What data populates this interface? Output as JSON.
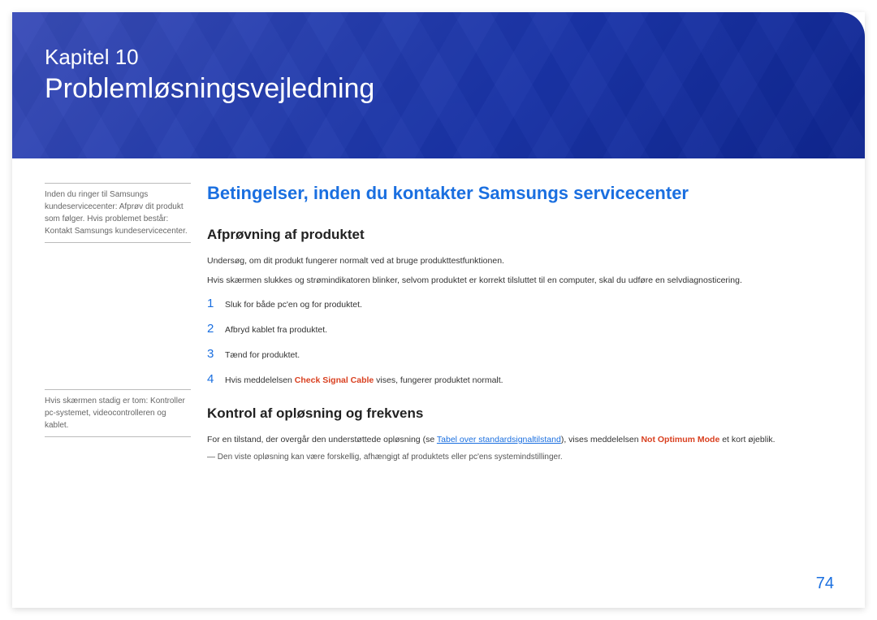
{
  "banner": {
    "chapter_label": "Kapitel 10",
    "chapter_title": "Problemløsningsvejledning"
  },
  "side": {
    "note1": "Inden du ringer til Samsungs kundeservicecenter: Afprøv dit produkt som følger. Hvis problemet består: Kontakt Samsungs kundeservicecenter.",
    "note2": "Hvis skærmen stadig er tom: Kontroller pc-systemet, videocontrolleren og kablet."
  },
  "main": {
    "section_title": "Betingelser, inden du kontakter Samsungs servicecenter",
    "sub1_title": "Afprøvning af produktet",
    "sub1_p1": "Undersøg, om dit produkt fungerer normalt ved at bruge produkttestfunktionen.",
    "sub1_p2": "Hvis skærmen slukkes og strømindikatoren blinker, selvom produktet er korrekt tilsluttet til en computer, skal du udføre en selvdiagnosticering.",
    "steps": [
      "Sluk for både pc'en og for produktet.",
      "Afbryd kablet fra produktet.",
      "Tænd for produktet."
    ],
    "step4_prefix": "Hvis meddelelsen ",
    "step4_highlight": "Check Signal Cable",
    "step4_suffix": " vises, fungerer produktet normalt.",
    "sub2_title": "Kontrol af opløsning og frekvens",
    "sub2_p_prefix": "For en tilstand, der overgår den understøttede opløsning (se ",
    "sub2_link": "Tabel over standardsignaltilstand",
    "sub2_p_mid": "), vises meddelelsen ",
    "sub2_highlight": "Not Optimum Mode",
    "sub2_p_suffix": " et kort øjeblik.",
    "sub2_footnote": "Den viste opløsning kan være forskellig, afhængigt af produktets eller pc'ens systemindstillinger."
  },
  "page_number": "74"
}
